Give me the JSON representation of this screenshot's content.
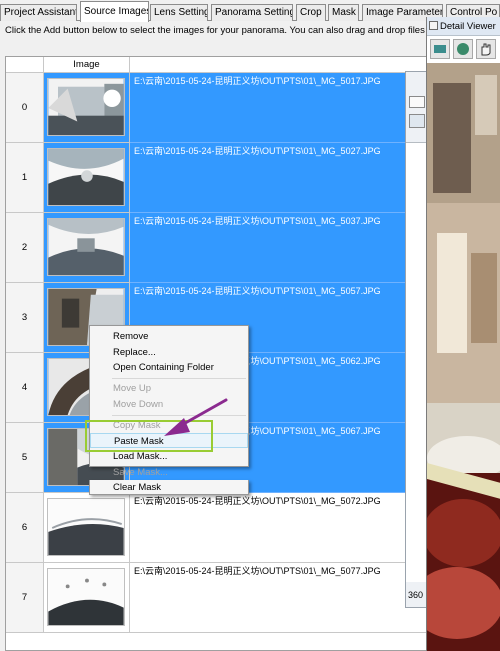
{
  "tabs": [
    {
      "label": "Project Assistant",
      "active": false
    },
    {
      "label": "Source Images",
      "active": true
    },
    {
      "label": "Lens Settings",
      "active": false
    },
    {
      "label": "Panorama Settings",
      "active": false
    },
    {
      "label": "Crop",
      "active": false
    },
    {
      "label": "Mask",
      "active": false
    },
    {
      "label": "Image Parameters",
      "active": false
    },
    {
      "label": "Control Po",
      "active": false
    }
  ],
  "hint": "Click the Add button below to select the images for your panorama. You can also drag and drop files",
  "table": {
    "image_header": "Image",
    "rows": [
      {
        "index": "0",
        "path": "E:\\云南\\2015-05-24-昆明正义坊\\OUT\\PTS\\01\\_MG_5017.JPG",
        "selected": true
      },
      {
        "index": "1",
        "path": "E:\\云南\\2015-05-24-昆明正义坊\\OUT\\PTS\\01\\_MG_5027.JPG",
        "selected": true
      },
      {
        "index": "2",
        "path": "E:\\云南\\2015-05-24-昆明正义坊\\OUT\\PTS\\01\\_MG_5037.JPG",
        "selected": true
      },
      {
        "index": "3",
        "path": "E:\\云南\\2015-05-24-昆明正义坊\\OUT\\PTS\\01\\_MG_5057.JPG",
        "selected": true
      },
      {
        "index": "4",
        "path": "E:\\云南\\2015-05-24-昆明正义坊\\OUT\\PTS\\01\\_MG_5062.JPG",
        "selected": true
      },
      {
        "index": "5",
        "path": "E:\\云南\\2015-05-24-昆明正义坊\\OUT\\PTS\\01\\_MG_5067.JPG",
        "selected": true
      },
      {
        "index": "6",
        "path": "E:\\云南\\2015-05-24-昆明正义坊\\OUT\\PTS\\01\\_MG_5072.JPG",
        "selected": false
      },
      {
        "index": "7",
        "path": "E:\\云南\\2015-05-24-昆明正义坊\\OUT\\PTS\\01\\_MG_5077.JPG",
        "selected": false
      }
    ]
  },
  "context_menu": {
    "items": [
      {
        "label": "Remove",
        "disabled": false
      },
      {
        "label": "Replace...",
        "disabled": false
      },
      {
        "label": "Open Containing Folder",
        "disabled": false
      },
      {
        "label": "Move Up",
        "disabled": true
      },
      {
        "label": "Move Down",
        "disabled": true
      },
      {
        "label": "Copy Mask",
        "disabled": true
      },
      {
        "label": "Paste Mask",
        "disabled": false,
        "highlighted": true
      },
      {
        "label": "Load Mask...",
        "disabled": false
      },
      {
        "label": "Save Mask...",
        "disabled": true
      },
      {
        "label": "Clear Mask",
        "disabled": false
      }
    ]
  },
  "detail_viewer": {
    "title": "Detail Viewer"
  },
  "side_panel": {
    "label": "360"
  },
  "colors": {
    "selection": "#3399ff",
    "callout_box": "#99cc33",
    "arrow": "#8b2a8f"
  }
}
